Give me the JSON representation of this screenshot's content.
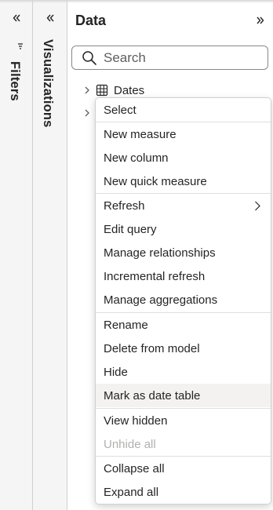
{
  "filters_pane": {
    "label": "Filters"
  },
  "visualizations_pane": {
    "label": "Visualizations"
  },
  "data_pane": {
    "title": "Data",
    "search": {
      "placeholder": "Search",
      "value": ""
    },
    "tables": [
      {
        "label": "Dates"
      }
    ]
  },
  "context_menu": {
    "select": "Select",
    "new_measure": "New measure",
    "new_column": "New column",
    "new_quick_measure": "New quick measure",
    "refresh": "Refresh",
    "edit_query": "Edit query",
    "manage_relationships": "Manage relationships",
    "incremental_refresh": "Incremental refresh",
    "manage_aggregations": "Manage aggregations",
    "rename": "Rename",
    "delete_from_model": "Delete from model",
    "hide": "Hide",
    "mark_as_date_table": "Mark as date table",
    "view_hidden": "View hidden",
    "unhide_all": "Unhide all",
    "collapse_all": "Collapse all",
    "expand_all": "Expand all"
  }
}
